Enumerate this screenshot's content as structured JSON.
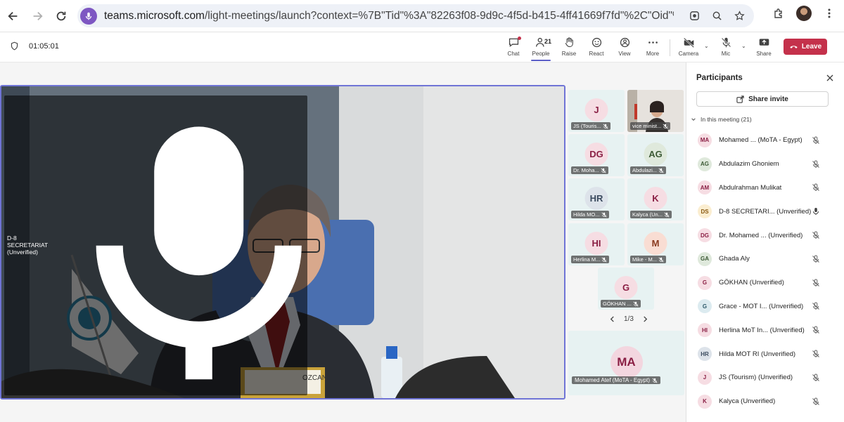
{
  "browser": {
    "url_host": "teams.microsoft.com",
    "url_rest": "/light-meetings/launch?context=%7B\"Tid\"%3A\"82263f08-9d9c-4f5d-b415-4ff41669f7fd\"%2C\"Oid\"%3A\"cfc951a4-a22e-..."
  },
  "toolbar": {
    "timer": "01:05:01",
    "chat": "Chat",
    "people": "People",
    "people_count": "21",
    "raise": "Raise",
    "react": "React",
    "view": "View",
    "more": "More",
    "camera": "Camera",
    "mic": "Mic",
    "share": "Share",
    "leave": "Leave"
  },
  "main_video": {
    "name": "D-8 SECRETARIAT (Unverified)",
    "nameplate": "OZCAN"
  },
  "tiles": [
    {
      "initials": "J",
      "name": "JS (Touris...",
      "bg": "#f6dde3",
      "fg": "#8a1f44"
    },
    {
      "initials": "",
      "name": "vice minist...",
      "bg": "#d9d9d9",
      "fg": "#333333"
    },
    {
      "initials": "DG",
      "name": "Dr. Moha...",
      "bg": "#f6dde3",
      "fg": "#8a1f44"
    },
    {
      "initials": "AG",
      "name": "Abdulazi...",
      "bg": "#dfe9dc",
      "fg": "#3c5a35"
    },
    {
      "initials": "HR",
      "name": "Hilda MO...",
      "bg": "#dde3ea",
      "fg": "#3a4a5e"
    },
    {
      "initials": "K",
      "name": "Kalyca (Un...",
      "bg": "#f6dde3",
      "fg": "#8a1f44"
    },
    {
      "initials": "HI",
      "name": "Herlina M...",
      "bg": "#f6dde3",
      "fg": "#8a1f44"
    },
    {
      "initials": "M",
      "name": "Mike - M...",
      "bg": "#f9ddd3",
      "fg": "#8a3a1f"
    },
    {
      "initials": "G",
      "name": "GÖKHAN ...",
      "bg": "#f6dde3",
      "fg": "#8a1f44"
    }
  ],
  "pager": {
    "label": "1/3"
  },
  "big_tile": {
    "initials": "MA",
    "name": "Mohamed Atef (MoTA - Egypt)"
  },
  "panel": {
    "title": "Participants",
    "share_invite": "Share invite",
    "section": "In this meeting (21)",
    "participants": [
      {
        "initials": "MA",
        "name": "Mohamed ...  (MoTA - Egypt)",
        "bg": "#f6dde3",
        "fg": "#8a1f44",
        "mic": "muted"
      },
      {
        "initials": "AG",
        "name": "Abdulazim Ghoniem",
        "bg": "#dfe9dc",
        "fg": "#3c5a35",
        "mic": "muted"
      },
      {
        "initials": "AM",
        "name": "Abdulrahman Mulikat",
        "bg": "#f6dde3",
        "fg": "#8a1f44",
        "mic": "muted"
      },
      {
        "initials": "DS",
        "name": "D-8 SECRETARI... (Unverified)",
        "bg": "#fbeed1",
        "fg": "#8a5a12",
        "mic": "on"
      },
      {
        "initials": "DG",
        "name": "Dr. Mohamed ...  (Unverified)",
        "bg": "#f6dde3",
        "fg": "#8a1f44",
        "mic": "muted"
      },
      {
        "initials": "GA",
        "name": "Ghada Aly",
        "bg": "#dfe9dc",
        "fg": "#3c5a35",
        "mic": "muted"
      },
      {
        "initials": "G",
        "name": "GÖKHAN (Unverified)",
        "bg": "#f6dde3",
        "fg": "#8a1f44",
        "mic": "muted"
      },
      {
        "initials": "G",
        "name": "Grace - MOT I...   (Unverified)",
        "bg": "#dcebf0",
        "fg": "#2e5a6a",
        "mic": "muted"
      },
      {
        "initials": "HI",
        "name": "Herlina MoT In...  (Unverified)",
        "bg": "#f6dde3",
        "fg": "#8a1f44",
        "mic": "muted"
      },
      {
        "initials": "HR",
        "name": "Hilda MOT RI (Unverified)",
        "bg": "#dde3ea",
        "fg": "#3a4a5e",
        "mic": "muted"
      },
      {
        "initials": "J",
        "name": "JS (Tourism) (Unverified)",
        "bg": "#f6dde3",
        "fg": "#8a1f44",
        "mic": "muted"
      },
      {
        "initials": "K",
        "name": "Kalyca (Unverified)",
        "bg": "#f6dde3",
        "fg": "#8a1f44",
        "mic": "muted"
      }
    ]
  }
}
